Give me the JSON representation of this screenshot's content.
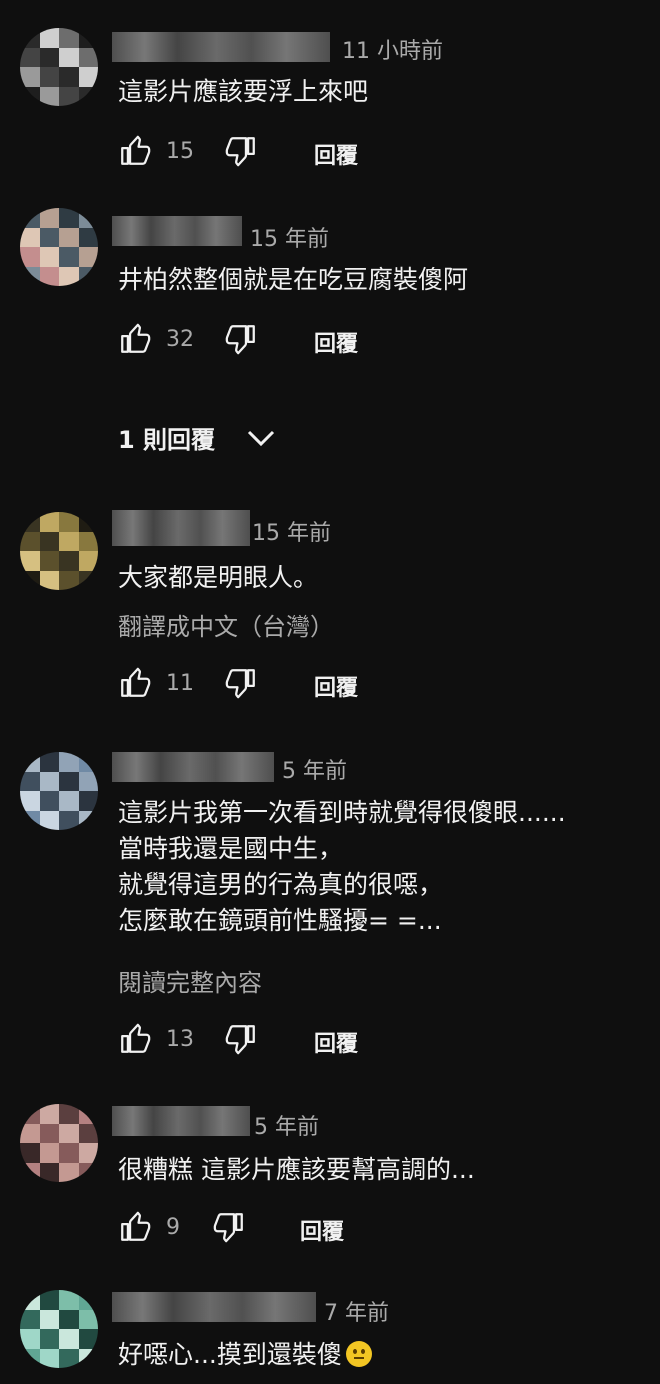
{
  "comments": [
    {
      "time": "11 小時前",
      "text": [
        "這影片應該要浮上來吧"
      ],
      "likes": "15",
      "reply_label": "回覆"
    },
    {
      "time": "15 年前",
      "text": [
        "井柏然整個就是在吃豆腐裝傻阿"
      ],
      "likes": "32",
      "reply_label": "回覆",
      "replies_toggle": "1 則回覆"
    },
    {
      "time": "15 年前",
      "text": [
        "大家都是明眼人。"
      ],
      "translate_label": "翻譯成中文（台灣）",
      "likes": "11",
      "reply_label": "回覆"
    },
    {
      "time": "5 年前",
      "text": [
        "這影片我第一次看到時就覺得很傻眼......",
        "當時我還是國中生，",
        "就覺得這男的行為真的很噁，",
        "怎麼敢在鏡頭前性騷擾= =..."
      ],
      "read_more_label": "閱讀完整內容",
      "likes": "13",
      "reply_label": "回覆"
    },
    {
      "time": "5 年前",
      "text": [
        "很糟糕 這影片應該要幫高調的..."
      ],
      "likes": "9",
      "reply_label": "回覆"
    },
    {
      "time": "7 年前",
      "text": [
        "好噁心...摸到還裝傻"
      ],
      "emoji": "neutral-face-emoji"
    }
  ],
  "icons": {
    "like": "thumbs-up-icon",
    "dislike": "thumbs-down-icon",
    "expand": "chevron-down-icon"
  },
  "colors": {
    "background": "#0f0f0f",
    "primary_text": "#f1f1f1",
    "secondary_text": "#aaaaaa"
  }
}
